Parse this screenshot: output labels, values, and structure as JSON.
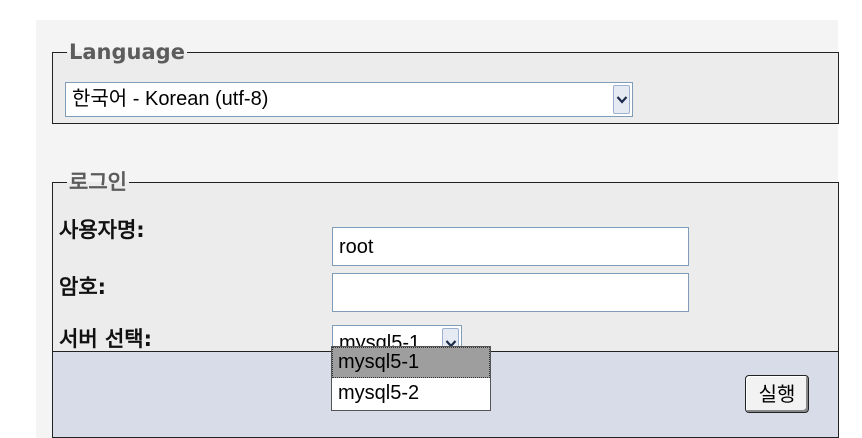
{
  "language": {
    "legend": "Language",
    "selected": "한국어 - Korean (utf-8)"
  },
  "login": {
    "legend": "로그인",
    "username_label": "사용자명:",
    "username_value": "root",
    "password_label": "암호:",
    "password_value": "",
    "server_label": "서버 선택:",
    "server_selected": "mysql5-1",
    "server_options": [
      "mysql5-1",
      "mysql5-2"
    ],
    "submit_label": "실행"
  },
  "colors": {
    "input_border": "#7f9db9",
    "submit_bar_bg": "#d8dce8",
    "fieldset_bg": "#ececec",
    "highlight_option": "#9e9e9e"
  }
}
